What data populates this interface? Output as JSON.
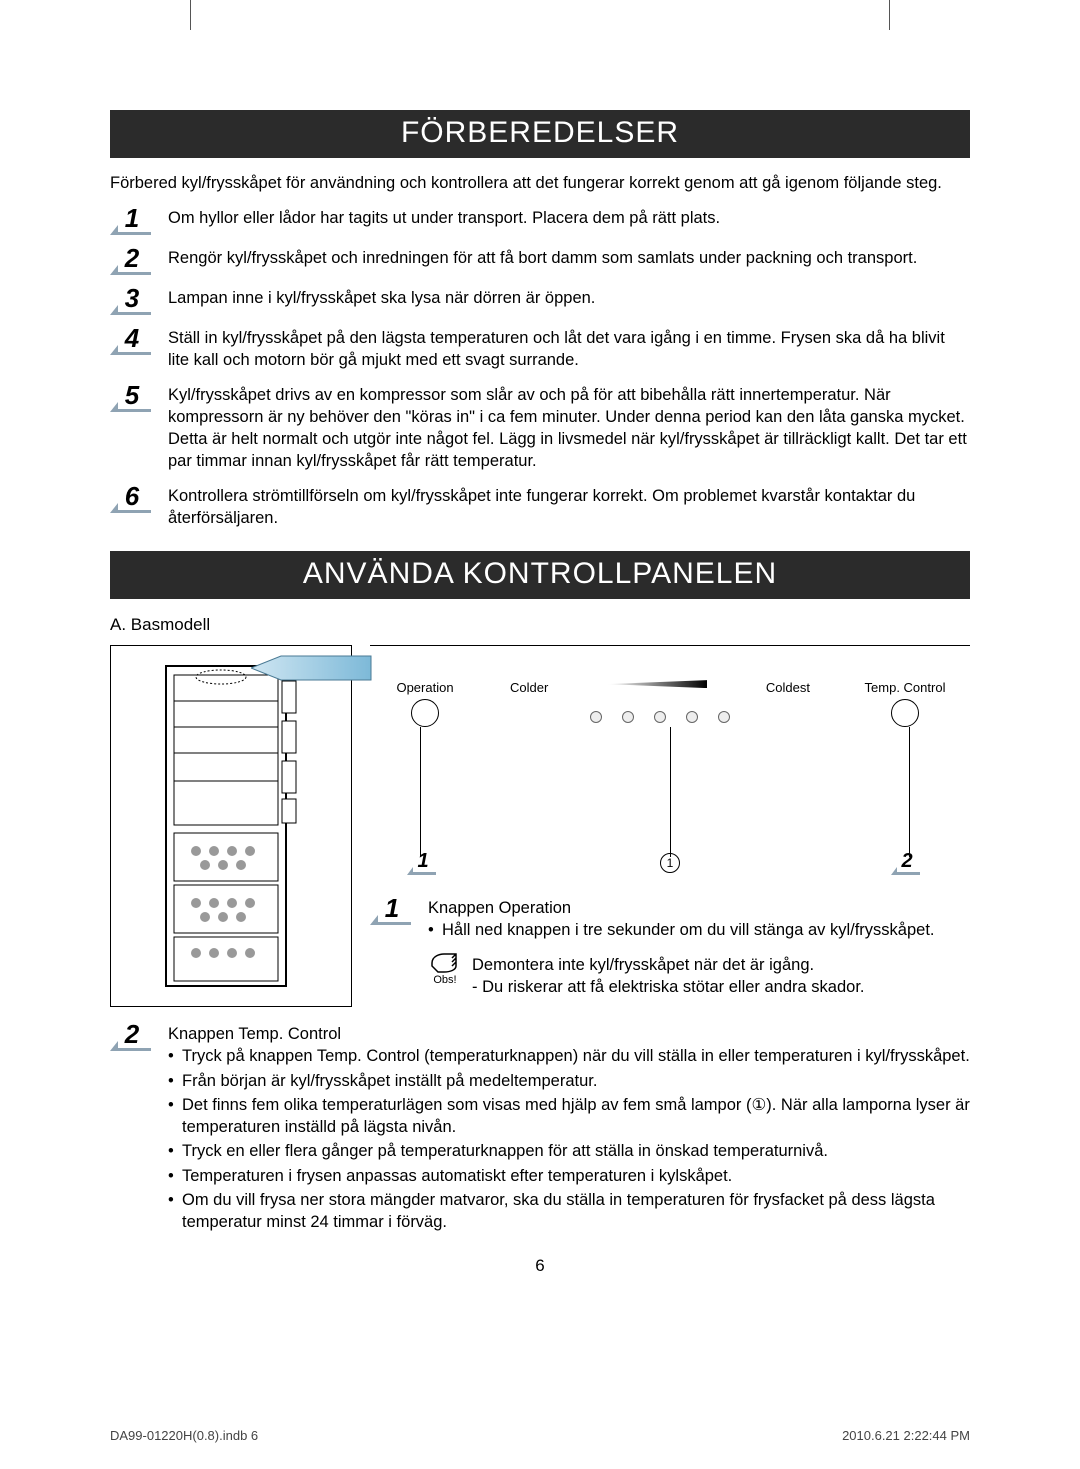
{
  "page_number": "6",
  "footer": {
    "left": "DA99-01220H(0.8).indb   6",
    "right": "2010.6.21   2:22:44 PM"
  },
  "section1": {
    "title": "FÖRBEREDELSER",
    "intro": "Förbered kyl/frysskåpet för användning och kontrollera att det fungerar korrekt genom att gå igenom följande steg.",
    "steps": [
      "Om hyllor eller lådor har tagits ut under transport. Placera dem på rätt plats.",
      "Rengör kyl/frysskåpet och inredningen för att få bort damm som samlats under packning och transport.",
      "Lampan inne i kyl/frysskåpet ska lysa när dörren är öppen.",
      "Ställ in kyl/frysskåpet på den lägsta temperaturen och låt det vara igång i en timme. Frysen ska då ha blivit lite kall och motorn bör gå mjukt med ett svagt surrande.",
      "Kyl/frysskåpet drivs av en kompressor som slår av och på för att bibehålla rätt innertemperatur. När kompressorn är ny behöver den \"köras in\" i ca fem minuter. Under denna period kan den låta ganska mycket. Detta är helt normalt och utgör inte något fel. Lägg in livsmedel när kyl/frysskåpet är tillräckligt kallt. Det tar ett par timmar innan kyl/frysskåpet får rätt temperatur.",
      "Kontrollera strömtillförseln om kyl/frysskåpet inte fungerar korrekt. Om problemet kvarstår kontaktar du återförsäljaren."
    ]
  },
  "section2": {
    "title": "ANVÄNDA KONTROLLPANELEN",
    "model_label": "A. Basmodell",
    "panel_labels": {
      "operation": "Operation",
      "colder": "Colder",
      "coldest": "Coldest",
      "temp_control": "Temp. Control"
    },
    "marker_center": "1",
    "button1": {
      "title": "Knappen Operation",
      "bullet": "Håll ned knappen i tre sekunder om du vill stänga av kyl/frysskåpet.",
      "note_label": "Obs!",
      "note_line1": "Demontera inte kyl/frysskåpet när det är igång.",
      "note_line2": "- Du riskerar att få elektriska stötar eller andra skador."
    },
    "button2": {
      "title": "Knappen Temp. Control",
      "bullets": [
        "Tryck på knappen Temp. Control (temperaturknappen) när du vill ställa in eller temperaturen i kyl/frysskåpet.",
        "Från början är kyl/frysskåpet inställt på medeltemperatur.",
        "Det finns fem olika temperaturlägen som visas med hjälp av fem små lampor (①). När alla lamporna lyser är temperaturen inställd på lägsta nivån.",
        "Tryck en eller flera gånger på temperaturknappen för att ställa in önskad temperaturnivå.",
        "Temperaturen i frysen anpassas automatiskt efter temperaturen i kylskåpet.",
        "Om du vill frysa ner stora mängder matvaror, ska du ställa in temperaturen för frysfacket på dess lägsta temperatur minst 24 timmar i förväg."
      ]
    }
  }
}
